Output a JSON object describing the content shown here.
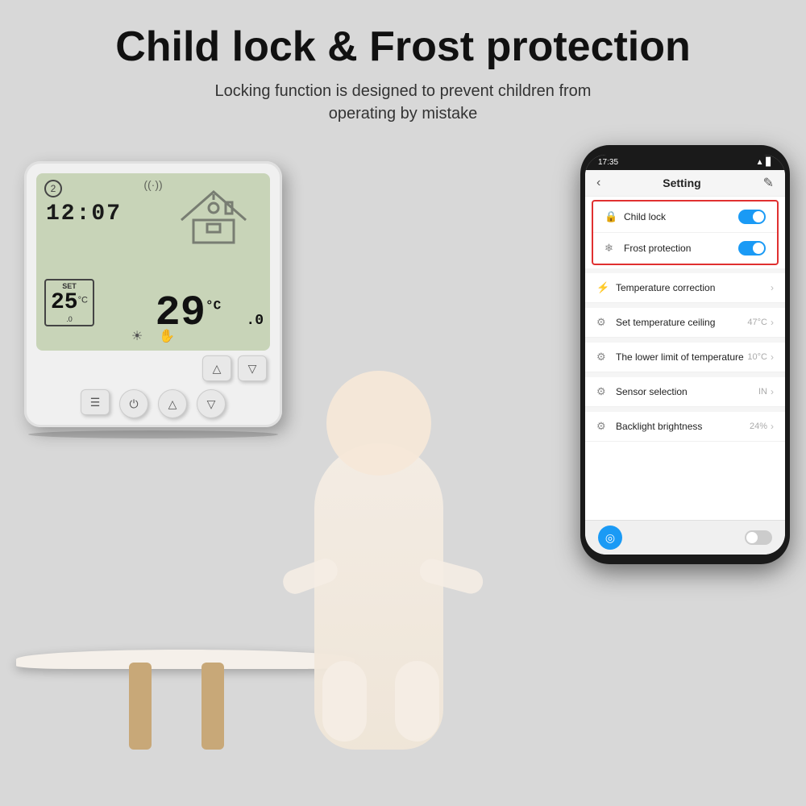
{
  "header": {
    "title": "Child lock & Frost protection",
    "subtitle_line1": "Locking function is designed to prevent children from",
    "subtitle_line2": "operating by mistake"
  },
  "phone": {
    "status_bar": {
      "time": "17:35",
      "right_icons": "▲ ◀ 🔋"
    },
    "nav": {
      "back_icon": "‹",
      "title": "Setting",
      "edit_icon": "✎"
    },
    "settings": [
      {
        "icon": "🔒",
        "label": "Child lock",
        "type": "toggle",
        "state": "on",
        "value": "",
        "highlighted": true
      },
      {
        "icon": "❄",
        "label": "Frost protection",
        "type": "toggle",
        "state": "on",
        "value": "",
        "highlighted": true
      },
      {
        "icon": "⚡",
        "label": "Temperature correction",
        "type": "chevron",
        "state": "",
        "value": ""
      },
      {
        "icon": "⚙",
        "label": "Set temperature ceiling",
        "type": "chevron",
        "state": "",
        "value": "47°C"
      },
      {
        "icon": "⚙",
        "label": "The lower limit of temperature",
        "type": "chevron",
        "state": "",
        "value": "10°C"
      },
      {
        "icon": "⚙",
        "label": "Sensor selection",
        "type": "chevron",
        "state": "",
        "value": "IN"
      },
      {
        "icon": "⚙",
        "label": "Backlight brightness",
        "type": "chevron",
        "state": "",
        "value": "24%"
      }
    ],
    "bottom": {
      "toggle_state": "off"
    }
  },
  "thermostat": {
    "circle_num": "2",
    "time": "12:07",
    "set_label": "SET",
    "set_temp": "25",
    "set_unit": "°C",
    "main_temp": "29",
    "main_unit": "°C",
    "decimal": ".0"
  }
}
